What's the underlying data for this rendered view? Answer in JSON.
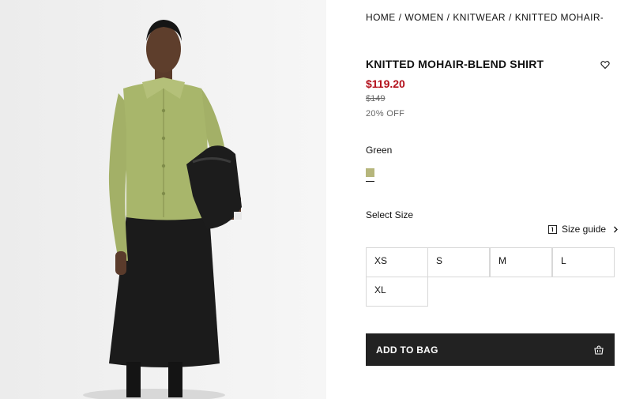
{
  "breadcrumb": {
    "items": [
      "HOME",
      "WOMEN",
      "KNITWEAR",
      "KNITTED MOHAIR-BLEND SHIRT"
    ],
    "separator": "/"
  },
  "product": {
    "title": "KNITTED MOHAIR-BLEND SHIRT",
    "price": "$119.20",
    "original_price": "$149",
    "discount": "20% OFF",
    "wishlist_icon": "heart-icon"
  },
  "color": {
    "name": "Green",
    "swatch_hex": "#b6b67c"
  },
  "sizes": {
    "label": "Select Size",
    "guide_label": "Size guide",
    "guide_icon": "ruler-icon",
    "options": [
      "XS",
      "S",
      "M",
      "L",
      "XL"
    ]
  },
  "cart": {
    "add_label": "ADD TO BAG",
    "bag_icon": "shopping-bag-icon"
  },
  "colors": {
    "price_red": "#b3101b",
    "button_bg": "#222222",
    "cardigan": "#a7b66a",
    "skirt": "#1a1a1a"
  }
}
